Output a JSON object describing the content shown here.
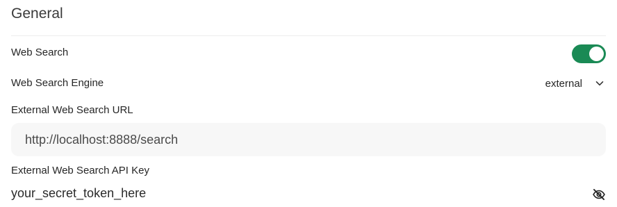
{
  "section": {
    "title": "General"
  },
  "web_search": {
    "label": "Web Search",
    "enabled": true,
    "accent": "#1a8a55"
  },
  "engine": {
    "label": "Web Search Engine",
    "value": "external",
    "icon": "chevron-down-icon"
  },
  "url": {
    "label": "External Web Search URL",
    "value": "http://localhost:8888/search"
  },
  "api_key": {
    "label": "External Web Search API Key",
    "value": "your_secret_token_here",
    "icon": "eye-off-icon"
  }
}
